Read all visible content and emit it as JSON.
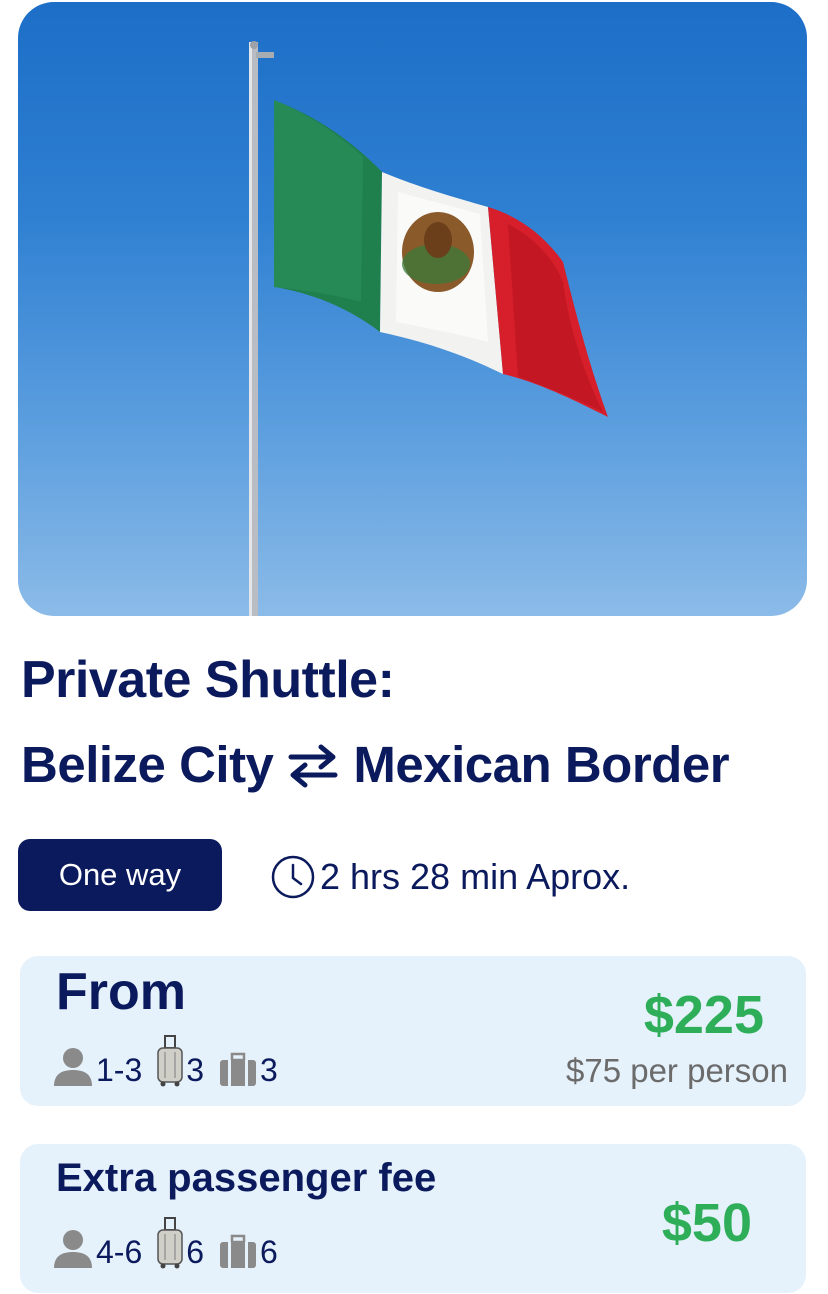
{
  "hero": {
    "image": "mexican-flag-on-pole-blue-sky"
  },
  "title": {
    "line1": "Private Shuttle:",
    "origin": "Belize City",
    "destination": "Mexican Border",
    "route_icon": "swap-arrows-icon"
  },
  "trip": {
    "type_label": "One way",
    "duration": "2 hrs  28 min Aprox.",
    "duration_icon": "clock-icon"
  },
  "base_fare": {
    "label": "From",
    "passengers": "1-3",
    "suitcases": "3",
    "bags": "3",
    "price": "$225",
    "per_person": "$75 per person"
  },
  "extra_fee": {
    "label": "Extra passenger fee",
    "passengers": "4-6",
    "suitcases": "6",
    "bags": "6",
    "price": "$50"
  },
  "colors": {
    "navy": "#0b1a5c",
    "green": "#2fae5a",
    "card": "#e5f1fb",
    "icon_gray": "#8a8a8a"
  }
}
